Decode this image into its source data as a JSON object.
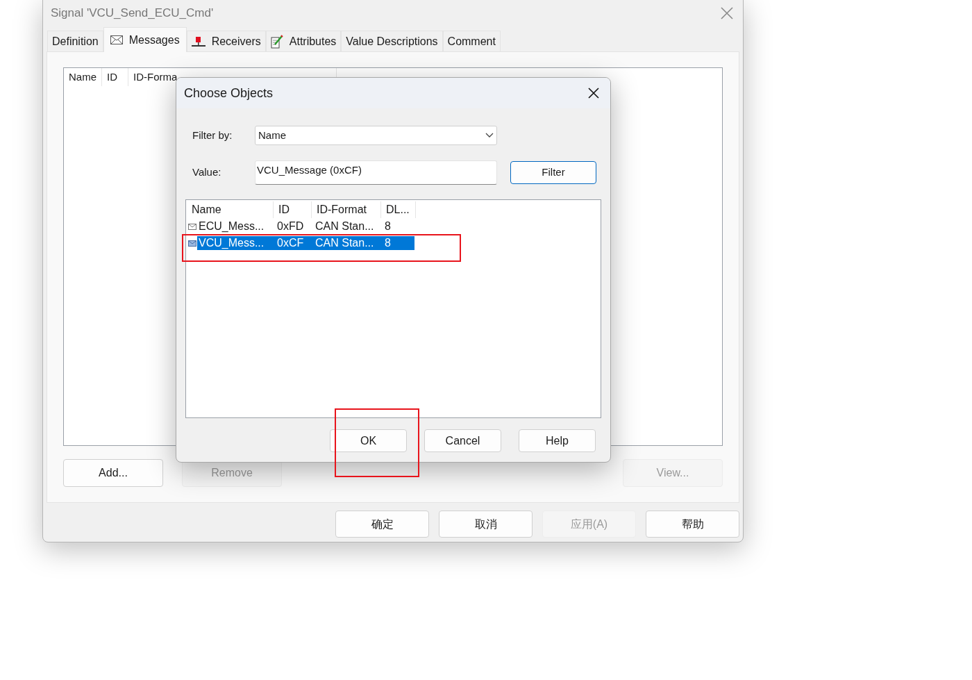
{
  "window": {
    "title": "Signal 'VCU_Send_ECU_Cmd'"
  },
  "tabs": [
    {
      "label": "Definition",
      "selected": false
    },
    {
      "label": "Messages",
      "selected": true
    },
    {
      "label": "Receivers",
      "selected": false
    },
    {
      "label": "Attributes",
      "selected": false
    },
    {
      "label": "Value Descriptions",
      "selected": false
    },
    {
      "label": "Comment",
      "selected": false
    }
  ],
  "messages_list": {
    "columns": [
      "Name",
      "ID",
      "ID-Forma"
    ]
  },
  "panel_buttons": [
    {
      "label": "Add...",
      "disabled": false
    },
    {
      "label": "Remove",
      "disabled": true
    },
    {
      "label": "View...",
      "disabled": true
    }
  ],
  "footer_buttons": [
    {
      "label": "确定",
      "disabled": false
    },
    {
      "label": "取消",
      "disabled": false
    },
    {
      "label": "应用(A)",
      "disabled": true
    },
    {
      "label": "帮助",
      "disabled": false
    }
  ],
  "dialog": {
    "title": "Choose Objects",
    "filter_by_label": "Filter by:",
    "filter_by_value": "Name",
    "value_label": "Value:",
    "value": "VCU_Message (0xCF)",
    "filter_button": "Filter",
    "columns": [
      "Name",
      "ID",
      "ID-Format",
      "DL..."
    ],
    "rows": [
      {
        "cells": [
          "ECU_Mess...",
          "0xFD",
          "CAN Stan...",
          "8"
        ],
        "selected": false
      },
      {
        "cells": [
          "VCU_Mess...",
          "0xCF",
          "CAN Stan...",
          "8"
        ],
        "selected": true
      }
    ],
    "buttons": [
      "OK",
      "Cancel",
      "Help"
    ]
  }
}
